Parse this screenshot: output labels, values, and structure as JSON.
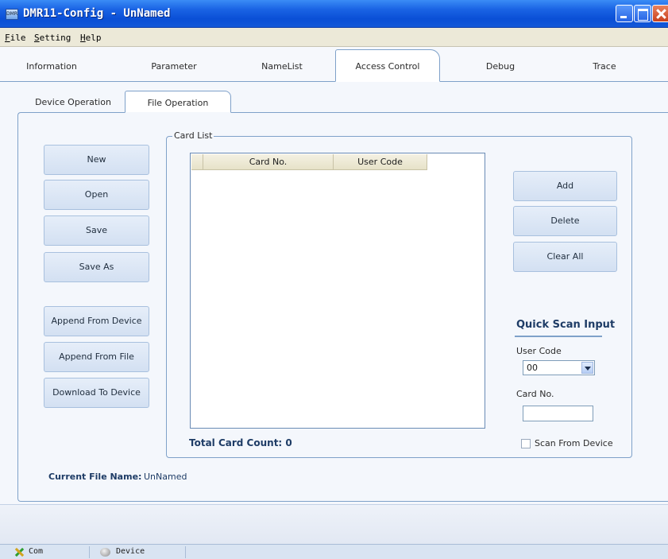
{
  "window": {
    "title": "DMR11-Config - UnNamed",
    "icon": "app-icon"
  },
  "menu": [
    {
      "accel": "F",
      "rest": "ile"
    },
    {
      "accel": "S",
      "rest": "etting"
    },
    {
      "accel": "H",
      "rest": "elp"
    }
  ],
  "main_tabs": [
    "Information",
    "Parameter",
    "NameList",
    "Access Control",
    "Debug",
    "Trace"
  ],
  "main_tab_selected": "Access Control",
  "sub_tabs": [
    "Device Operation",
    "File Operation"
  ],
  "sub_tab_selected": "File Operation",
  "left_buttons": [
    "New",
    "Open",
    "Save",
    "Save As",
    "Append From Device",
    "Append From File",
    "Download To Device"
  ],
  "card_list": {
    "group_label": "Card List",
    "columns": [
      "Card No.",
      "User Code"
    ],
    "rows": []
  },
  "right_buttons": [
    "Add",
    "Delete",
    "Clear All"
  ],
  "total_label": "Total Card Count: 0",
  "quick_scan": {
    "title": "Quick Scan Input",
    "user_code_label": "User Code",
    "user_code_value": "00",
    "card_no_label": "Card No.",
    "card_no_value": "",
    "scan_checkbox_label": "Scan From Device",
    "scan_checked": false
  },
  "current_file": {
    "label": "Current File Name:",
    "value": "UnNamed"
  },
  "status": {
    "com": "Com",
    "device": "Device"
  },
  "colors": {
    "title_bar": "#0a4fd6",
    "panel_border": "#7fa1c9",
    "button_fill": "#d3e0f2",
    "heading_text": "#1e3c66",
    "close_button": "#c9401c"
  }
}
